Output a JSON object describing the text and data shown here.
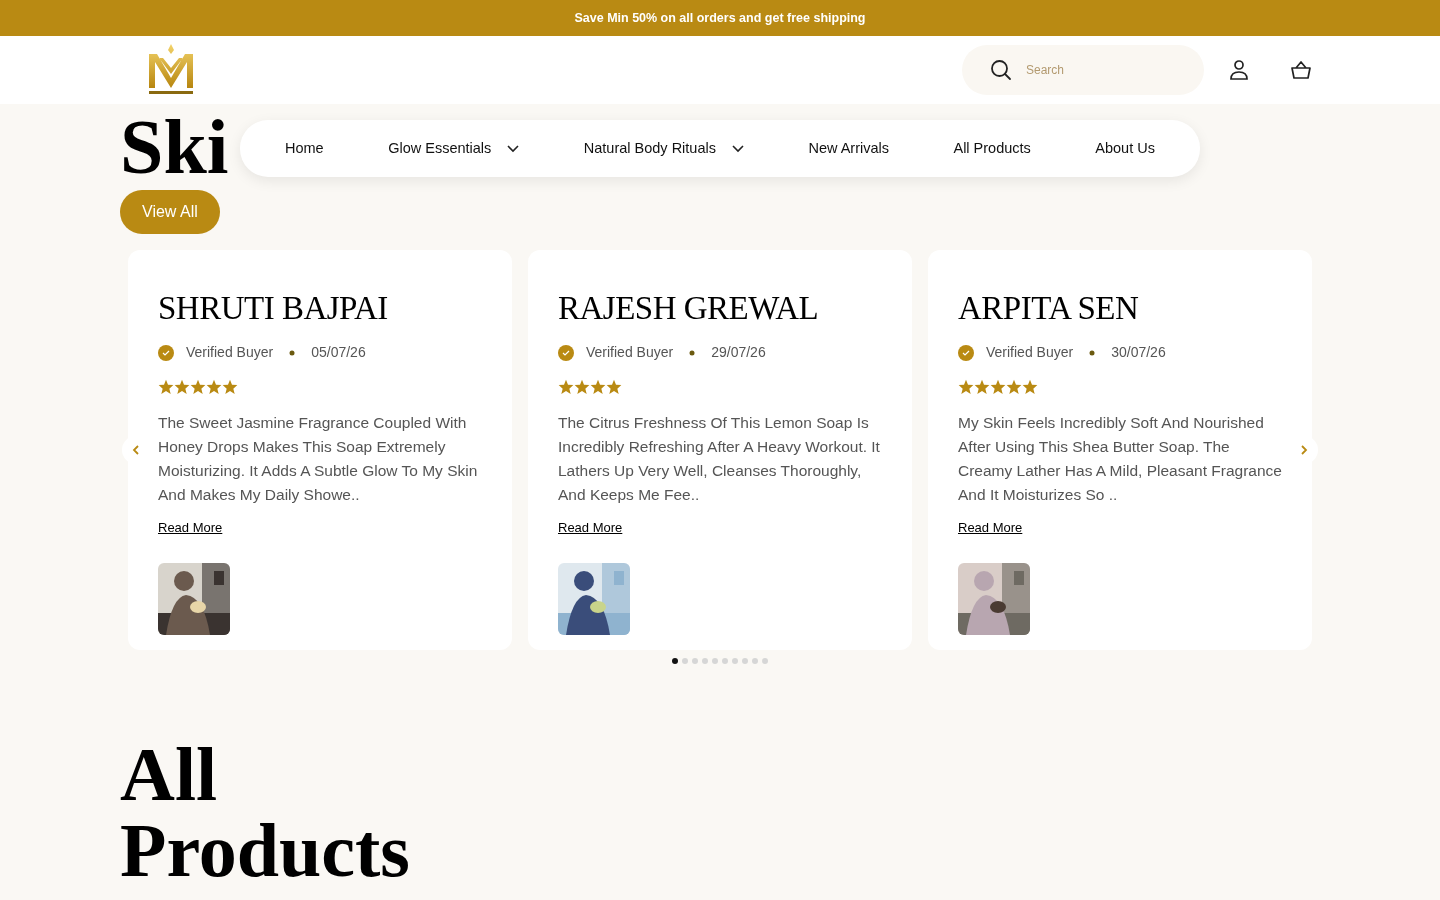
{
  "announcement": "Save Min 50% on all orders and get free shipping",
  "search": {
    "placeholder": "Search"
  },
  "nav": [
    {
      "label": "Home",
      "dropdown": false
    },
    {
      "label": "Glow Essentials",
      "dropdown": true
    },
    {
      "label": "Natural Body Rituals",
      "dropdown": true
    },
    {
      "label": "New Arrivals",
      "dropdown": false
    },
    {
      "label": "All Products",
      "dropdown": false
    },
    {
      "label": "About Us",
      "dropdown": false
    }
  ],
  "section": {
    "heading": "Ski",
    "button": "View All"
  },
  "reviews": [
    {
      "name": "SHRUTI BAJPAI",
      "badge": "Verified Buyer",
      "date": "05/07/26",
      "stars": 5,
      "text": "The Sweet Jasmine Fragrance Coupled With Honey Drops Makes This Soap Extremely Moisturizing. It Adds A Subtle Glow To My Skin And Makes My Daily Showe..",
      "link": "Read More"
    },
    {
      "name": "RAJESH GREWAL",
      "badge": "Verified Buyer",
      "date": "29/07/26",
      "stars": 4,
      "text": "The Citrus Freshness Of This Lemon Soap Is Incredibly Refreshing After A Heavy Workout. It Lathers Up Very Well, Cleanses Thoroughly, And Keeps Me Fee..",
      "link": "Read More"
    },
    {
      "name": "ARPITA SEN",
      "badge": "Verified Buyer",
      "date": "30/07/26",
      "stars": 5,
      "text": "My Skin Feels Incredibly Soft And Nourished After Using This Shea Butter Soap. The Creamy Lather Has A Mild, Pleasant Fragrance And It Moisturizes So ..",
      "link": "Read More"
    }
  ],
  "pagination": [
    {
      "selected": true
    },
    {
      "selected": false
    },
    {
      "selected": false
    },
    {
      "selected": false
    },
    {
      "selected": false
    },
    {
      "selected": false
    },
    {
      "selected": false
    },
    {
      "selected": false
    },
    {
      "selected": false
    },
    {
      "selected": false
    }
  ],
  "products_heading": "All Products"
}
